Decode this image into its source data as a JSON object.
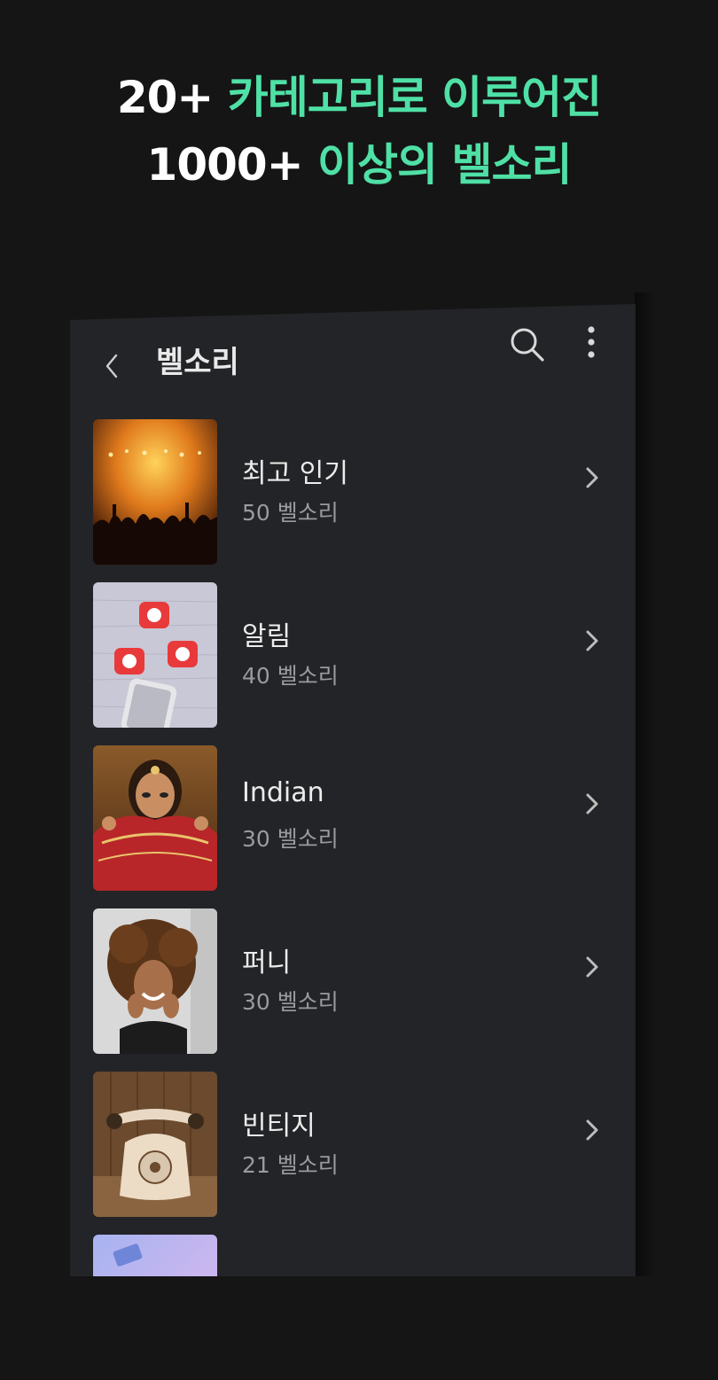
{
  "promo": {
    "line1_number": "20+",
    "line1_text": "카테고리로 이루어진",
    "line2_number": "1000+",
    "line2_text": "이상의 벨소리"
  },
  "app": {
    "title": "벨소리",
    "icons": {
      "back": "chevron-left-icon",
      "search": "search-icon",
      "more": "more-vertical-icon",
      "row": "chevron-right-icon"
    }
  },
  "categories": [
    {
      "title": "최고 인기",
      "count": "50 벨소리"
    },
    {
      "title": "알림",
      "count": "40 벨소리"
    },
    {
      "title": "Indian",
      "count": "30 벨소리"
    },
    {
      "title": "퍼니",
      "count": "30 벨소리"
    },
    {
      "title": "빈티지",
      "count": "21 벨소리"
    }
  ],
  "colors": {
    "background": "#151515",
    "panel": "#232427",
    "accent": "#4fe0a6",
    "title_text": "#ececec",
    "secondary_text": "#9a9b9e"
  }
}
